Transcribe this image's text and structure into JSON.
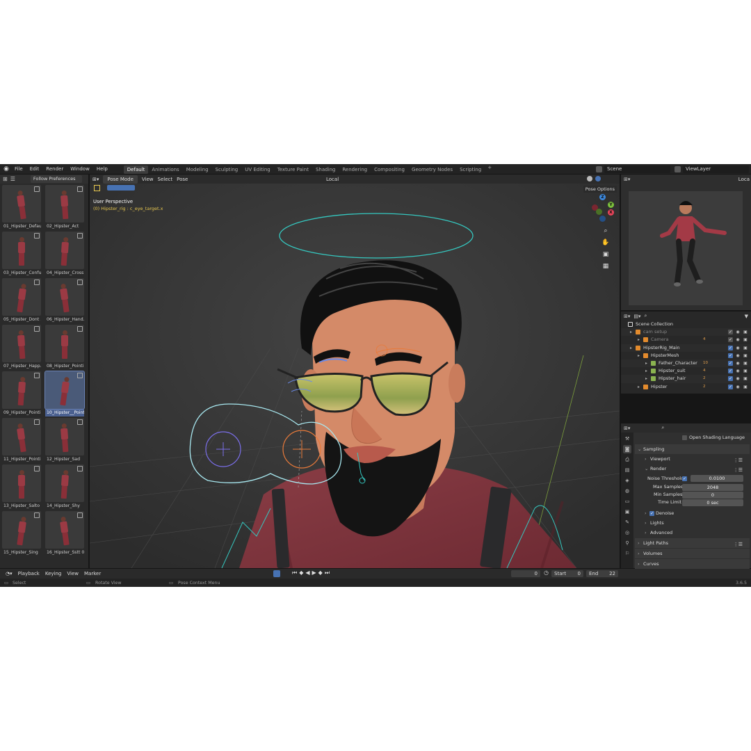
{
  "topbar": {
    "menus": [
      "File",
      "Edit",
      "Render",
      "Window",
      "Help"
    ],
    "workspaces": [
      "Default",
      "Animations",
      "Modeling",
      "Sculpting",
      "UV Editing",
      "Texture Paint",
      "Shading",
      "Rendering",
      "Compositing",
      "Geometry Nodes",
      "Scripting"
    ],
    "active_workspace": "Default",
    "add_workspace": "+",
    "scene": "Scene",
    "view_layer": "ViewLayer"
  },
  "asset_browser": {
    "library": "Follow Preferences",
    "items": [
      "01_Hipster_Default",
      "02_Hipster_Act",
      "03_Hipster_Confu...",
      "04_Hipster_Cross...",
      "05_Hipster_Dont ...",
      "06_Hipster_Hand...",
      "07_Hipster_Happ...",
      "08_Hipster_Pointi...",
      "09_Hipster_Pointi...",
      "10_Hipster__Point...",
      "11_Hipster_Pointi...",
      "12_Hipster_Sad",
      "13_Hipster_Salto",
      "14_Hipster_Shy",
      "15_Hipster_Sing",
      "16_Hipster_Sstt 01"
    ],
    "selected_index": 9
  },
  "viewport": {
    "mode": "Pose Mode",
    "menus": [
      "View",
      "Select",
      "Pose"
    ],
    "transform_orientation": "Local",
    "pose_options": "Pose Options",
    "perspective": "User Perspective",
    "active_object": "(0) Hipster_rig : c_eye_target.x",
    "gizmo_z": "Z",
    "gizmo_y": "Y",
    "gizmo_x": "X",
    "colors": {
      "x_axis": "#e8445a",
      "y_axis": "#7bbf3c",
      "z_axis": "#3d8ae0",
      "selection": "#e8c850"
    }
  },
  "preview": {
    "view_label": "Loca"
  },
  "outliner": {
    "rows": [
      {
        "label": "Scene Collection",
        "indent": 0
      },
      {
        "label": "cam setup",
        "indent": 1,
        "dim": true
      },
      {
        "label": "Camera",
        "indent": 2,
        "dim": true,
        "count": "4"
      },
      {
        "label": "HipsterRig_Main",
        "indent": 1
      },
      {
        "label": "HipsterMesh",
        "indent": 2
      },
      {
        "label": "Father_Character",
        "indent": 3,
        "count": "10"
      },
      {
        "label": "Hipster_suit",
        "indent": 3,
        "count": "4"
      },
      {
        "label": "Hipster_hair",
        "indent": 3,
        "count": "2"
      },
      {
        "label": "Hipster",
        "indent": 2,
        "count": "2"
      }
    ]
  },
  "properties": {
    "open_shading_language": "Open Shading Language",
    "sampling": "Sampling",
    "viewport": "Viewport",
    "render": "Render",
    "noise_threshold_label": "Noise Threshold",
    "noise_threshold_value": "0.0100",
    "max_samples_label": "Max Samples",
    "max_samples_value": "2048",
    "min_samples_label": "Min Samples",
    "min_samples_value": "0",
    "time_limit_label": "Time Limit",
    "time_limit_value": "0 sec",
    "denoise": "Denoise",
    "lights": "Lights",
    "advanced": "Advanced",
    "light_paths": "Light Paths",
    "volumes": "Volumes",
    "curves": "Curves"
  },
  "timeline": {
    "menus": [
      "Playback",
      "Keying",
      "View",
      "Marker"
    ],
    "current_frame": "0",
    "start_label": "Start",
    "start_value": "0",
    "end_label": "End",
    "end_value": "22"
  },
  "statusbar": {
    "select": "Select",
    "rotate": "Rotate View",
    "context": "Pose Context Menu",
    "version": "3.6.5"
  }
}
